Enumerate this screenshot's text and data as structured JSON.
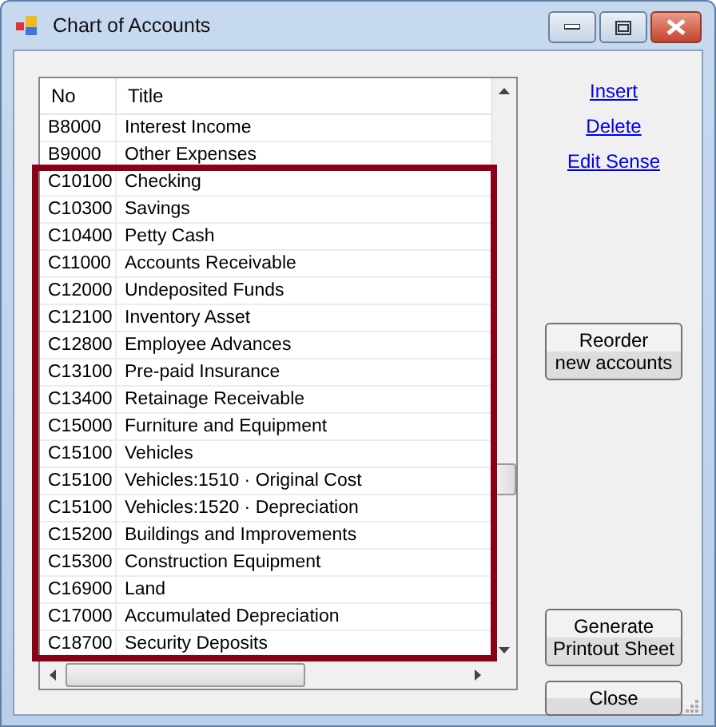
{
  "window": {
    "title": "Chart of Accounts"
  },
  "table": {
    "columns": [
      "No",
      "Title"
    ],
    "rows": [
      {
        "no": "B8000",
        "title": "Interest Income"
      },
      {
        "no": "B9000",
        "title": "Other Expenses"
      }
    ],
    "highlighted_rows": [
      {
        "no": "C10100",
        "title": "Checking"
      },
      {
        "no": "C10300",
        "title": "Savings"
      },
      {
        "no": "C10400",
        "title": "Petty Cash"
      },
      {
        "no": "C11000",
        "title": "Accounts Receivable"
      },
      {
        "no": "C12000",
        "title": "Undeposited Funds"
      },
      {
        "no": "C12100",
        "title": "Inventory Asset"
      },
      {
        "no": "C12800",
        "title": "Employee Advances"
      },
      {
        "no": "C13100",
        "title": "Pre-paid Insurance"
      },
      {
        "no": "C13400",
        "title": "Retainage Receivable"
      },
      {
        "no": "C15000",
        "title": "Furniture and Equipment"
      },
      {
        "no": "C15100",
        "title": "Vehicles"
      },
      {
        "no": "C15100",
        "title": "Vehicles:1510 · Original Cost"
      },
      {
        "no": "C15100",
        "title": "Vehicles:1520 · Depreciation"
      },
      {
        "no": "C15200",
        "title": "Buildings and Improvements"
      },
      {
        "no": "C15300",
        "title": "Construction Equipment"
      },
      {
        "no": "C16900",
        "title": "Land"
      },
      {
        "no": "C17000",
        "title": "Accumulated Depreciation"
      },
      {
        "no": "C18700",
        "title": "Security Deposits"
      }
    ]
  },
  "links": [
    "Insert",
    "Delete",
    "Edit Sense"
  ],
  "buttons": [
    {
      "label": "Reorder\nnew accounts",
      "kind": "top"
    },
    {
      "label": "Generate\nPrintout Sheet",
      "kind": "bottom"
    },
    {
      "label": "Close",
      "kind": "bottom"
    }
  ]
}
